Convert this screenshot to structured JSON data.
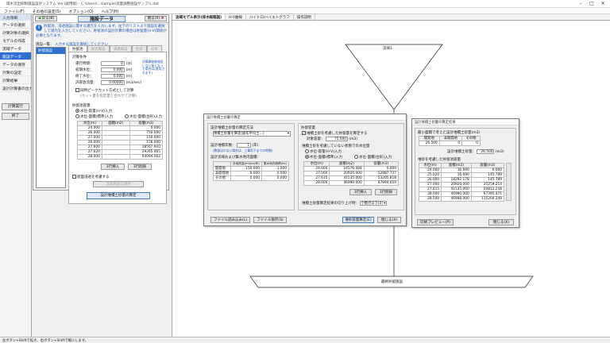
{
  "title": "雨水流出抑制施設設計システム Ver.(試用版) - C:\\Users\\...\\sample\\流量調整施設サンプル.dat",
  "menu": [
    "ファイル(F)",
    "その他の設定(S)",
    "オプション(O)",
    "ヘルプ(H)"
  ],
  "nav": {
    "header": "入力項目",
    "items": [
      "データの選択",
      "計算対象の選択",
      "モデルの作成",
      "流域データ",
      "施設データ",
      "データの保存",
      "計算の設定",
      "計算結果",
      "設計計算書の出力"
    ],
    "selected_index": 4,
    "calc_btn": "計算実行",
    "end_btn": "終了"
  },
  "panel": {
    "back": "戻る(B)",
    "title": "施設データ",
    "close": "閉る(X)",
    "note": "貯留池、浸透施設に関する諸元を入力します。左下のリストより施設を選択して諸元を入力してください。貯留池の設計計算の場合は貯留量(H-V)関係が必要となります。",
    "list_label": "施設一覧：",
    "list_hint": "入力する施設を選択してください",
    "list_item": "貯留施設",
    "tabs": [
      "貯留池",
      "放流施設",
      "浸透施設",
      "合流",
      "分水"
    ],
    "section1": "計算条件",
    "fields": [
      {
        "label": "運行時間：",
        "value": "0",
        "unit": "(分)"
      },
      {
        "label": "初期水位：",
        "value": "0.000",
        "unit": "(m)"
      },
      {
        "label": "終了水位：",
        "value": "0.000",
        "unit": "(m)"
      },
      {
        "label": "許容放流量：",
        "value": "0.00000",
        "unit": "(m3/sec)"
      }
    ],
    "side_note": "計算開始後施設にない量となった場合は(適用されます)",
    "peak_cut": "同時ピークカット方式として計算",
    "peak_cut2": "(カット量を指定量と合わせて計算)",
    "section2": "貯留池容量",
    "radio": [
      "水位-容量(H-V)入力",
      "水位-面積(標準)入力",
      "水位-面積(台形)入力"
    ],
    "table_head": [
      "水位(m)",
      "面積(m2)",
      "容量(m3)"
    ],
    "table_rows": [
      [
        "24.000",
        "",
        "0.000"
      ],
      [
        "26.000",
        "",
        "750.000"
      ],
      [
        "27.000",
        "",
        "150.000"
      ],
      [
        "26.000",
        "",
        "156.000"
      ],
      [
        "27.600",
        "",
        "18567.910"
      ],
      [
        "27.620",
        "",
        "29265.465"
      ],
      [
        "28.000",
        "",
        "64094.562"
      ]
    ],
    "row_insert": "1行挿入",
    "row_delete": "1行削除",
    "bottom_chk": "底面浸透を考慮する",
    "disabled_btn": "浸透施設の選択",
    "calc_btn": "設計堆積土砂量の算定"
  },
  "work": {
    "tabs": [
      "流域モデル表示(排水経路図)",
      "H-V曲線",
      "ハイドロ/ハイエトグラフ",
      "操作説明"
    ],
    "top_label": "流域1",
    "bottom_label": "最終貯留施設"
  },
  "dlg1": {
    "title": "設計堆積土砂量の算定",
    "s1": "設計堆積土砂量の算定方法",
    "method": "堆積土砂量を算定(面年平均土…)",
    "load_label": "設計堆積年数：",
    "load_value": "1",
    "load_unit": "(年)",
    "load_note": "(数量は少ない場合は、工事用下までの時間)",
    "area_label": "設計流域および集水地内面積：",
    "area_head": [
      "",
      "計画的量(m3/ha/年)",
      "集水地内面積(ha)"
    ],
    "area_rows": [
      [
        "開発地",
        "150.000",
        "1.000"
      ],
      [
        "非開発地",
        "0.000",
        "0.000"
      ],
      [
        "その他",
        "0.000",
        "0.000"
      ]
    ],
    "s2": "貯留容量",
    "chk": "堆積土砂を考慮した貯留量を算定する",
    "vol_label": "対象容量：",
    "vol_value": "75.000",
    "vol_unit": "(m3)",
    "pool_note": "堆積土砂を考慮していない状態での水位量",
    "radio": [
      "水位-容量(H-V)入力",
      "水位-面積(標準)入力",
      "水位-面積(台形)入力"
    ],
    "head": [
      "水位(m)",
      "面積(m2)",
      "容量(m3)"
    ],
    "rows": [
      [
        "24.000",
        "14576.494",
        "0.000"
      ],
      [
        "27.000",
        "20920.000",
        "52887.727"
      ],
      [
        "27.615",
        "41535.000",
        "53205.818"
      ],
      [
        "28.000",
        "46990.000",
        "87894.659"
      ]
    ],
    "ins": "1行挿入",
    "del": "1行削除",
    "sel_label": "堆積土砂量算定結果の切り上げ時：",
    "sel_value": "小数点以下(0)",
    "b1": "ファイル読み込み(L)",
    "b2": "ファイル保存(S)",
    "b3": "堆砂容量算定(E)",
    "b4": "閉じる(X)"
  },
  "dlg2": {
    "title": "設計堆積土砂量の算定結果",
    "s1": "最小面積で考えた設計堆積土砂量(m3)",
    "head": [
      "開発地",
      "非開発地",
      "その他"
    ],
    "vals": [
      "26.500",
      "0",
      "0"
    ],
    "total_label": "設計堆積土砂量：",
    "total_value": "26.500",
    "total_unit": "(m3)",
    "s2": "堆砂を考慮した貯留池容量",
    "thead": [
      "水位(m)",
      "面積(m2)",
      "容量(m3)"
    ],
    "rows": [
      [
        "24.000",
        "16.690",
        "0.000"
      ],
      [
        "25.020",
        "16.690",
        "145.789"
      ],
      [
        "26.000",
        "18292.178",
        "145.789"
      ],
      [
        "27.000",
        "20920.000",
        "25259.214"
      ],
      [
        "27.615",
        "41535.000",
        "50811.258"
      ],
      [
        "28.000",
        "46990.000",
        "67395.471"
      ],
      [
        "28.500",
        "46998.000",
        "115204.249"
      ]
    ],
    "b1": "印刷プレビュー(P)",
    "b2": "閉じる(X)"
  },
  "status": "左ボタン+Shiftで拡大、右ボタン+Shiftで縮小します。"
}
